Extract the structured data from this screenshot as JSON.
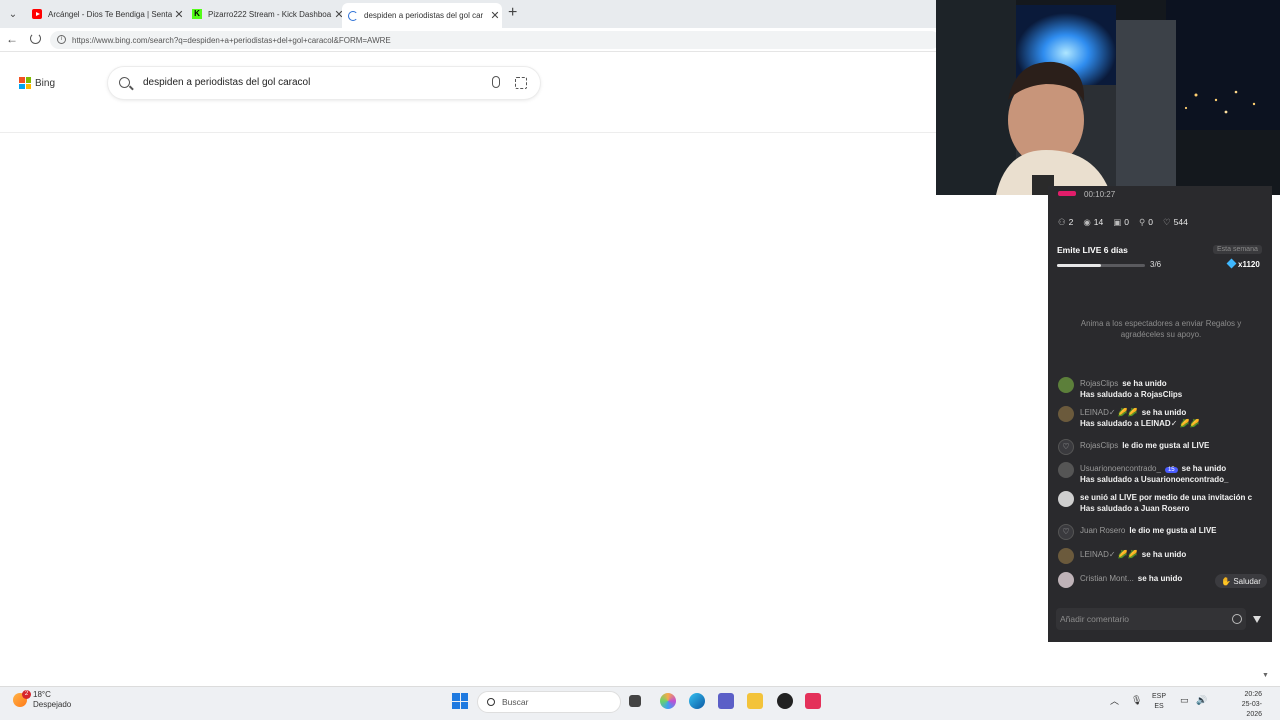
{
  "browser": {
    "tabs": [
      {
        "title": "Arcángel - Dios Te Bendiga | Senta",
        "icon": "youtube-icon"
      },
      {
        "title": "Pizarro222 Stream - Kick Dashboa",
        "icon": "kick-icon"
      },
      {
        "title": "despiden a periodistas del gol car",
        "icon": "loading-icon"
      }
    ],
    "url": "https://www.bing.com/search?q=despiden+a+periodistas+del+gol+caracol&FORM=AWRE"
  },
  "bing": {
    "logo_text": "Bing",
    "query": "despiden a periodistas del gol caracol"
  },
  "live_panel": {
    "timer": "00:10:27",
    "stats": {
      "people": "2",
      "views": "14",
      "gifts": "0",
      "shares": "0",
      "likes": "544"
    },
    "streak_title": "Emite LIVE 6 días",
    "streak_period": "Esta semana",
    "streak_progress_text": "3/6",
    "streak_progress": 0.5,
    "reward": "x1120",
    "hint": "Anima a los espectadores a enviar Regalos y agradéceles su apoyo.",
    "messages": [
      {
        "user": "RojasClips",
        "action": "se ha unido",
        "line2": "Has saludado a RojasClips"
      },
      {
        "user": "LEINAD✓ 🌽🌽",
        "action": "se ha unido",
        "line2": "Has saludado a LEINAD✓ 🌽🌽"
      },
      {
        "user": "RojasClips",
        "action": "le dio me gusta al LIVE",
        "line2": ""
      },
      {
        "user": "Usuarionoencontrado_",
        "badge": "15",
        "action": "se ha unido",
        "line2": "Has saludado a Usuarionoencontrado_"
      },
      {
        "user": "",
        "action": "se unió al LIVE por medio de una invitación c",
        "line2": "Has saludado a Juan Rosero"
      },
      {
        "user": "Juan Rosero",
        "action": "le dio me gusta al LIVE",
        "line2": ""
      },
      {
        "user": "LEINAD✓ 🌽🌽",
        "action": "se ha unido",
        "line2": ""
      },
      {
        "user": "Cristian Mont...",
        "action": "se ha unido",
        "line2": ""
      }
    ],
    "saludar_label": "Saludar",
    "comment_placeholder": "Añadir comentario"
  },
  "taskbar": {
    "temperature": "18°C",
    "weather": "Despejado",
    "weather_badge": "2",
    "search_placeholder": "Buscar",
    "lang_top": "ESP",
    "lang_bottom": "ES",
    "time": "20:26",
    "date": "25-03-2026"
  }
}
